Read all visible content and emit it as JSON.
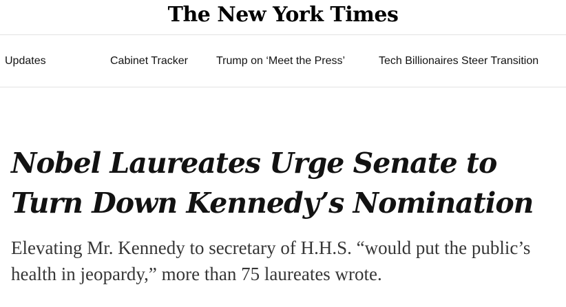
{
  "masthead": {
    "logo_text": "The New York Times"
  },
  "nav": {
    "items": [
      {
        "label": "Updates"
      },
      {
        "label": "Cabinet Tracker"
      },
      {
        "label": "Trump on ‘Meet the Press’"
      },
      {
        "label": "Tech Billionaires Steer Transition"
      }
    ]
  },
  "article": {
    "headline": "Nobel Laureates Urge Senate to Turn Down Kennedy’s Nomination",
    "summary": "Elevating Mr. Kennedy to secretary of H.H.S. “would put the public’s health in jeopardy,” more than 75 laureates wrote."
  }
}
